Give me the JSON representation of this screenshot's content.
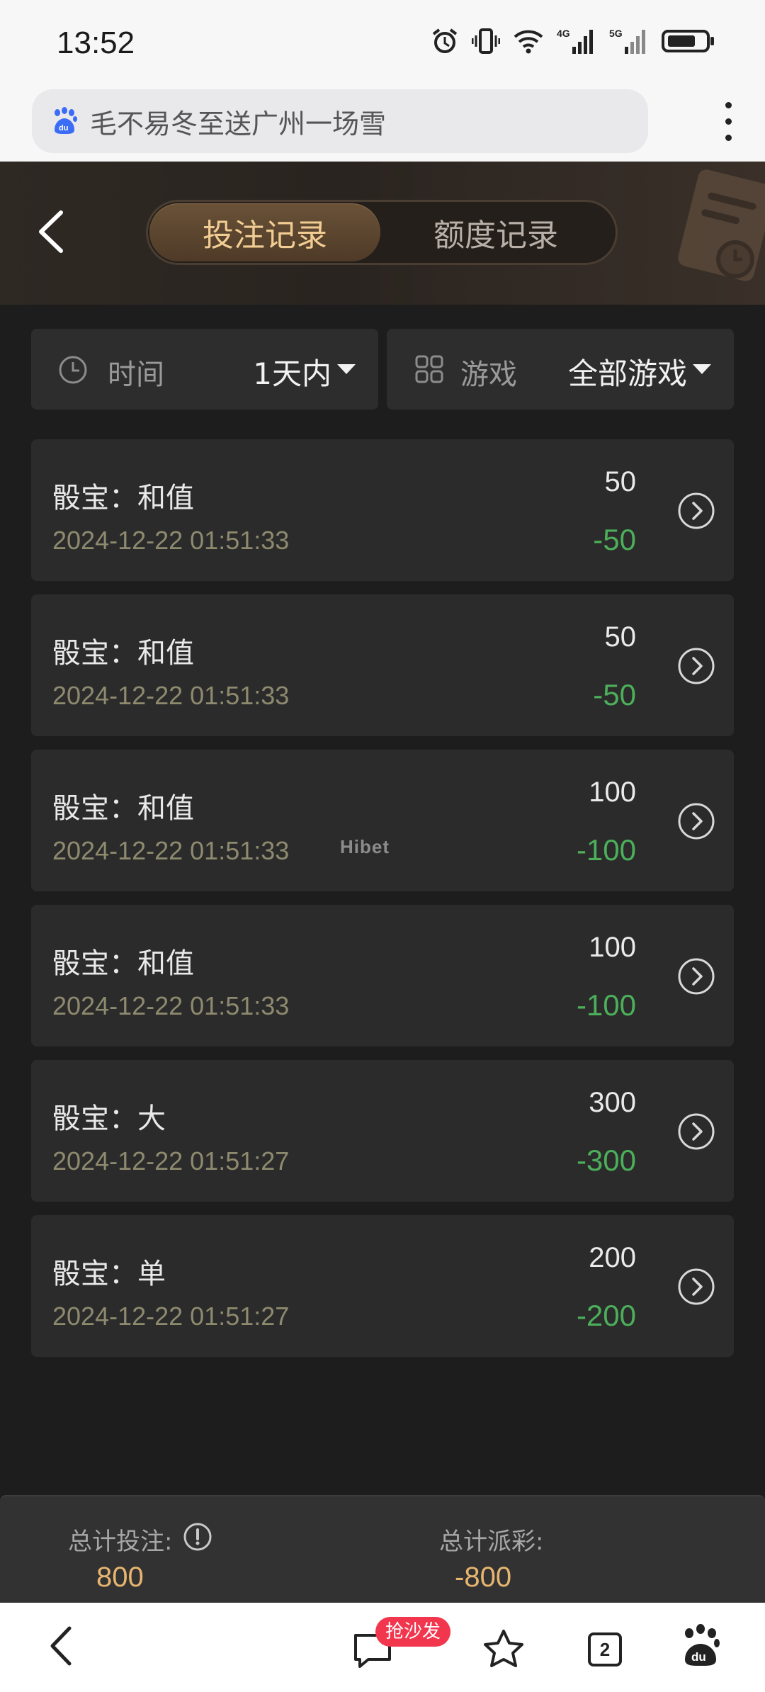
{
  "status_bar": {
    "time": "13:52",
    "network_1": "4G",
    "network_2": "5G"
  },
  "browser": {
    "url_text": "毛不易冬至送广州一场雪"
  },
  "tabs": [
    {
      "label": "投注记录",
      "active": true
    },
    {
      "label": "额度记录",
      "active": false
    }
  ],
  "filters": {
    "time": {
      "label": "时间",
      "value": "1天内"
    },
    "game": {
      "label": "游戏",
      "value": "全部游戏"
    }
  },
  "records": [
    {
      "title": "骰宝：和值",
      "time": "2024-12-22 01:51:33",
      "bet": "50",
      "win": "-50"
    },
    {
      "title": "骰宝：和值",
      "time": "2024-12-22 01:51:33",
      "bet": "50",
      "win": "-50"
    },
    {
      "title": "骰宝：和值",
      "time": "2024-12-22 01:51:33",
      "bet": "100",
      "win": "-100"
    },
    {
      "title": "骰宝：和值",
      "time": "2024-12-22 01:51:33",
      "bet": "100",
      "win": "-100"
    },
    {
      "title": "骰宝：大",
      "time": "2024-12-22 01:51:27",
      "bet": "300",
      "win": "-300"
    },
    {
      "title": "骰宝：单",
      "time": "2024-12-22 01:51:27",
      "bet": "200",
      "win": "-200"
    }
  ],
  "watermark": "Hibet",
  "summary": {
    "total_bet_label": "总计投注:",
    "total_bet": "800",
    "total_payout_label": "总计派彩:",
    "total_payout": "-800"
  },
  "bottom_nav": {
    "comment_badge": "抢沙发",
    "tab_count": "2"
  },
  "colors": {
    "accent_gold": "#f2cd93",
    "win_green": "#4caf5a",
    "sum_gold": "#e8b56f"
  }
}
